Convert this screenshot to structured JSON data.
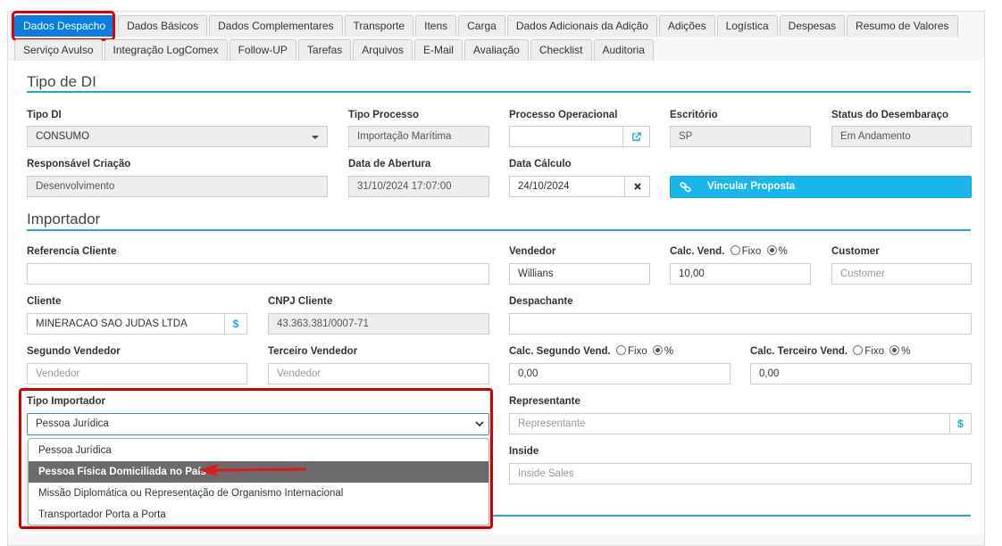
{
  "tabs_row1": [
    {
      "label": "Dados Despacho",
      "active": true
    },
    {
      "label": "Dados Básicos"
    },
    {
      "label": "Dados Complementares"
    },
    {
      "label": "Transporte"
    },
    {
      "label": "Itens"
    },
    {
      "label": "Carga"
    },
    {
      "label": "Dados Adicionais da Adição"
    },
    {
      "label": "Adições"
    },
    {
      "label": "Logística"
    },
    {
      "label": "Despesas"
    },
    {
      "label": "Resumo de Valores"
    }
  ],
  "tabs_row2": [
    {
      "label": "Serviço Avulso"
    },
    {
      "label": "Integração LogComex"
    },
    {
      "label": "Follow-UP"
    },
    {
      "label": "Tarefas"
    },
    {
      "label": "Arquivos"
    },
    {
      "label": "E-Mail"
    },
    {
      "label": "Avaliação"
    },
    {
      "label": "Checklist"
    },
    {
      "label": "Auditoria"
    }
  ],
  "tipo_di": {
    "title": "Tipo de DI",
    "tipo_di_label": "Tipo DI",
    "tipo_di_value": "CONSUMO",
    "tipo_processo_label": "Tipo Processo",
    "tipo_processo_value": "Importação Marítima",
    "processo_operacional_label": "Processo Operacional",
    "processo_operacional_value": "",
    "escritorio_label": "Escritório",
    "escritorio_value": "SP",
    "status_label": "Status do Desembaraço",
    "status_value": "Em Andamento",
    "responsavel_label": "Responsável Criação",
    "responsavel_value": "Desenvolvimento",
    "data_abertura_label": "Data de Abertura",
    "data_abertura_value": "31/10/2024 17:07:00",
    "data_calculo_label": "Data Cálculo",
    "data_calculo_value": "24/10/2024",
    "vincular_label": "Vincular Proposta"
  },
  "importador": {
    "title": "Importador",
    "referencia_label": "Referencia Cliente",
    "referencia_value": "",
    "vendedor_label": "Vendedor",
    "vendedor_value": "Willians",
    "calc_vend_label": "Calc. Vend.",
    "fixo_label": "Fixo",
    "pct_label": "%",
    "calc_vend_value": "10,00",
    "customer_label": "Customer",
    "customer_placeholder": "Customer",
    "cliente_label": "Cliente",
    "cliente_value": "MINERACAO SAO JUDAS LTDA",
    "cnpj_label": "CNPJ Cliente",
    "cnpj_value": "43.363.381/0007-71",
    "despachante_label": "Despachante",
    "despachante_value": "",
    "segundo_vendedor_label": "Segundo Vendedor",
    "segundo_vendedor_placeholder": "Vendedor",
    "terceiro_vendedor_label": "Terceiro Vendedor",
    "terceiro_vendedor_placeholder": "Vendedor",
    "calc_segundo_label": "Calc. Segundo Vend.",
    "calc_segundo_value": "0,00",
    "calc_terceiro_label": "Calc. Terceiro Vend.",
    "calc_terceiro_value": "0,00",
    "tipo_importador_label": "Tipo Importador",
    "tipo_importador_selected": "Pessoa Jurídica",
    "tipo_importador_options": [
      "Pessoa Jurídica",
      "Pessoa Física Domiciliada no País",
      "Missão Diplomática ou Representação de Organismo Internacional",
      "Transportador Porta a Porta"
    ],
    "representante_label": "Representante",
    "representante_placeholder": "Representante",
    "inside_label": "Inside",
    "inside_placeholder": "Inside Sales",
    "dollar_symbol": "$"
  },
  "colors": {
    "active_tab": "#0a7ee0",
    "section_line": "#18a9dd",
    "button": "#19b6ec",
    "highlight": "#e00000",
    "option_hover": "#6b6b6b"
  }
}
